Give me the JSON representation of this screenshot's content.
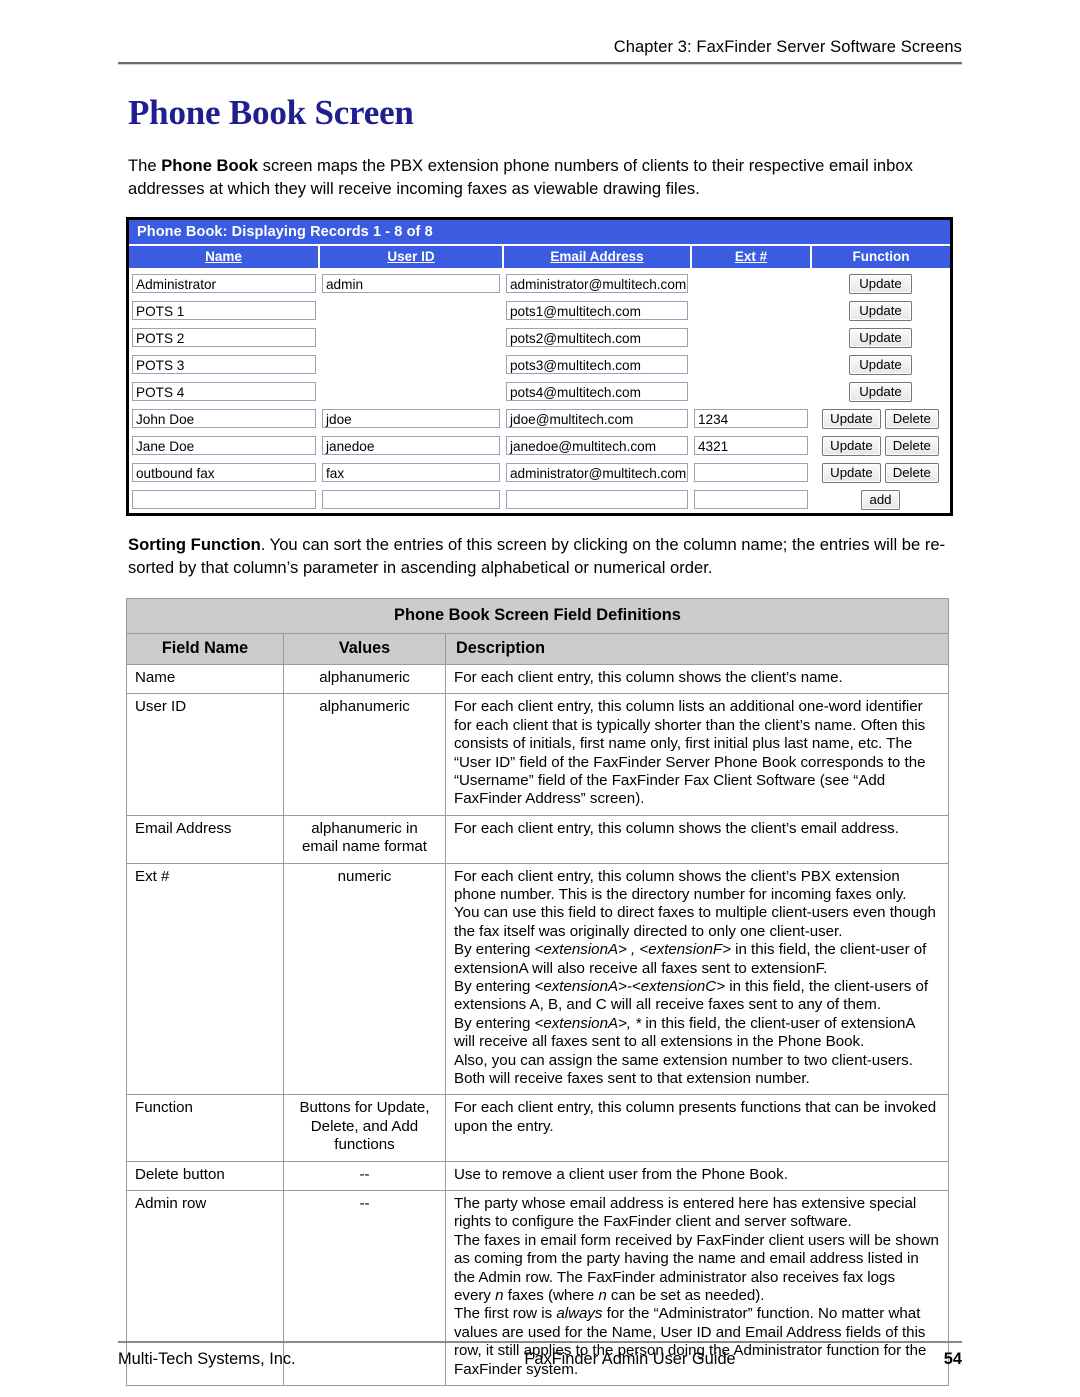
{
  "header": {
    "chapter_label": "Chapter 3:",
    "chapter_title": "FaxFinder Server Software Screens",
    "full": "Chapter 3: FaxFinder Server Software Screens"
  },
  "title": "Phone Book Screen",
  "intro": {
    "part1": "The ",
    "bold": "Phone Book",
    "part2": " screen maps the PBX extension phone numbers of clients to their respective email inbox addresses at which they will receive incoming faxes as viewable drawing files."
  },
  "screenshot": {
    "titlebar": "Phone Book: Displaying Records 1 - 8 of 8",
    "columns": [
      "Name",
      "User ID",
      "Email Address",
      "Ext #",
      "Function"
    ],
    "buttons": {
      "update": "Update",
      "delete": "Delete",
      "add": "add"
    },
    "rows": [
      {
        "name": "Administrator",
        "user_id": "admin",
        "email": "administrator@multitech.com",
        "ext": "",
        "functions": [
          "Update"
        ],
        "has_ext_box": false,
        "has_userid_box": true
      },
      {
        "name": "POTS 1",
        "user_id": "",
        "email": "pots1@multitech.com",
        "ext": "",
        "functions": [
          "Update"
        ],
        "has_ext_box": false,
        "has_userid_box": false
      },
      {
        "name": "POTS 2",
        "user_id": "",
        "email": "pots2@multitech.com",
        "ext": "",
        "functions": [
          "Update"
        ],
        "has_ext_box": false,
        "has_userid_box": false
      },
      {
        "name": "POTS 3",
        "user_id": "",
        "email": "pots3@multitech.com",
        "ext": "",
        "functions": [
          "Update"
        ],
        "has_ext_box": false,
        "has_userid_box": false
      },
      {
        "name": "POTS 4",
        "user_id": "",
        "email": "pots4@multitech.com",
        "ext": "",
        "functions": [
          "Update"
        ],
        "has_ext_box": false,
        "has_userid_box": false
      },
      {
        "name": "John Doe",
        "user_id": "jdoe",
        "email": "jdoe@multitech.com",
        "ext": "1234",
        "functions": [
          "Update",
          "Delete"
        ],
        "has_ext_box": true,
        "has_userid_box": true
      },
      {
        "name": "Jane Doe",
        "user_id": "janedoe",
        "email": "janedoe@multitech.com",
        "ext": "4321",
        "functions": [
          "Update",
          "Delete"
        ],
        "has_ext_box": true,
        "has_userid_box": true
      },
      {
        "name": "outbound fax",
        "user_id": "fax",
        "email": "administrator@multitech.com",
        "ext": "",
        "functions": [
          "Update",
          "Delete"
        ],
        "has_ext_box": true,
        "has_userid_box": true
      },
      {
        "name": "",
        "user_id": "",
        "email": "",
        "ext": "",
        "functions": [
          "add"
        ],
        "has_ext_box": true,
        "has_userid_box": true
      }
    ]
  },
  "sorting": {
    "bold": "Sorting Function",
    "text": ".  You can sort the entries of this screen by clicking on the column name; the entries will be re-sorted by that column’s parameter in ascending alphabetical or numerical order."
  },
  "defs_table": {
    "caption": "Phone Book Screen Field Definitions",
    "headers": [
      "Field Name",
      "Values",
      "Description"
    ],
    "rows": [
      {
        "field": "Name",
        "values": "alphanumeric",
        "desc_lines": [
          "For each client entry, this column shows the client’s name."
        ]
      },
      {
        "field": "User ID",
        "values": "alphanumeric",
        "desc_lines": [
          "For each client entry, this column lists an additional one-word identifier",
          "for each client that is typically shorter than the client’s name.  Often this",
          "consists of initials, first name only, first initial plus last name, etc. The",
          "“User ID” field of the FaxFinder Server Phone Book corresponds to the",
          "“Username” field of the FaxFinder Fax Client Software (see “Add",
          "FaxFinder Address” screen)."
        ]
      },
      {
        "field": "Email Address",
        "values": "alphanumeric in email name format",
        "desc_lines": [
          "For each client entry, this column shows the client’s email address."
        ]
      },
      {
        "field": "Ext #",
        "values": "numeric",
        "desc_lines": [
          "For each client entry, this column shows the client’s PBX extension",
          "phone number.  This is the directory number for incoming faxes only.",
          "You can use this field to direct faxes to multiple client-users even though",
          "the fax itself was originally directed to only one client-user.",
          "By entering <extensionA> , <extensionF> in this field, the client-user of",
          "extensionA will also receive all faxes sent to extensionF.",
          "By entering <extensionA>-<extensionC> in this field, the client-users of",
          "extensions A, B, and C will all receive faxes sent to any of them.",
          "By entering <extensionA>, * in this field, the client-user of extensionA",
          "will receive all faxes sent to all extensions in the Phone Book.",
          "Also, you can assign the same extension number to two client-users.",
          "Both will receive faxes sent to that extension number."
        ]
      },
      {
        "field": "Function",
        "values": "Buttons for Update, Delete, and Add functions",
        "desc_lines": [
          "For each client entry, this column presents functions that can be invoked",
          "upon the entry."
        ]
      },
      {
        "field": "Delete button",
        "values": "--",
        "desc_lines": [
          "Use to remove a client user from the Phone Book."
        ]
      },
      {
        "field": "Admin row",
        "values": "--",
        "desc_lines": [
          "The party whose email address is entered here has extensive special",
          "rights to configure the FaxFinder client and server software.",
          "The faxes in email form received by FaxFinder client users will be shown",
          "as coming from the party having the name and email address listed in",
          "the Admin row.  The FaxFinder administrator also receives fax logs",
          "every n faxes (where n can be set as needed).",
          "The first row is always for the “Administrator” function.  No matter what",
          "values are used for the Name, User ID and Email Address fields of this",
          "row, it still applies to the person doing the Administrator function for the",
          "FaxFinder system."
        ]
      }
    ]
  },
  "footer": {
    "company": "Multi-Tech Systems, Inc.",
    "guide": "FaxFinder Admin User Guide",
    "page_number": "54"
  },
  "colors": {
    "title_blue": "#1f1f8f",
    "app_blue": "#3b5ce0",
    "table_header_gray": "#cccccc"
  }
}
